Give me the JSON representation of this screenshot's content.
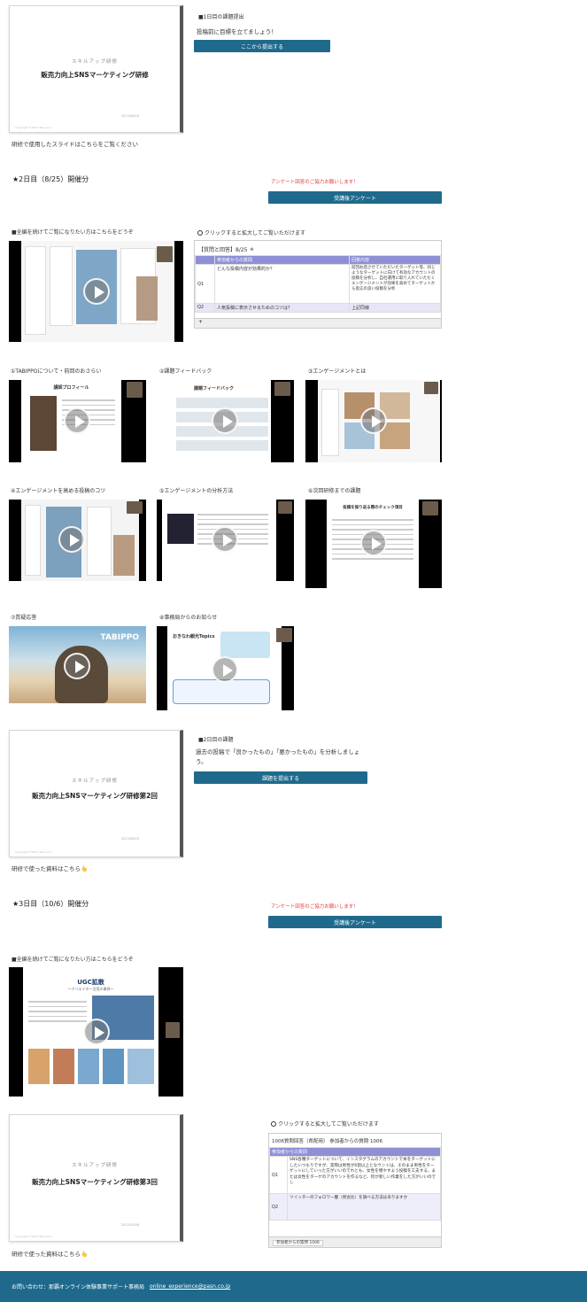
{
  "day1": {
    "slide": {
      "subtitle": "スキルアップ研修",
      "title": "販売力向上SNSマーケティング研修",
      "date": "2023/08/18",
      "footer": "Copyright ©2023 Tokyo Inc."
    },
    "slide_caption": "研修で使用したスライドはこちらをご覧ください",
    "assignment_heading": "■1日目の課題提出",
    "assignment_text": "投稿前に目標を立てましょう！",
    "submit_button": "ここから提出する"
  },
  "day2": {
    "heading": "★2日目（8/25）開催分",
    "survey_notice": "アンケート回答のご協力お願いします！",
    "survey_button": "受講後アンケート",
    "full_video_caption": "■全編を続けてご覧になりたい方はこちらをどうぞ",
    "sheet_hint": "クリックすると拡大してご覧いただけます",
    "sheet": {
      "title": "【質問と回答】8/25 ＊",
      "col1": "参加者からの質問",
      "col2": "回答内容",
      "rows": [
        {
          "no": "Q1",
          "q": "どんな投稿内容が効果的か？",
          "a": "前回お話させていただいたターゲット等、同じようなターゲットに向けて有効なアカウントの投稿を分析し、自社運用に取り入れていただくエンゲージメントが効果を高めてターゲットから反応の良い投稿を分析"
        },
        {
          "no": "Q2",
          "q": "人気投稿に表示させるためのコツは？",
          "a": "上記同様"
        }
      ],
      "tab": "+"
    },
    "videos": [
      {
        "caption": "①TABIPPOについて・前回のおさらい",
        "slide_title": "講師プロフィール"
      },
      {
        "caption": "②課題フィードバック",
        "slide_title": "課題フィードバック"
      },
      {
        "caption": "③エンゲージメントとは",
        "slide_title": ""
      },
      {
        "caption": "④エンゲージメントを高める投稿のコツ",
        "slide_title": ""
      },
      {
        "caption": "⑤エンゲージメントの分析方法",
        "slide_title": ""
      },
      {
        "caption": "⑥次回研修までの課題",
        "slide_title": "投稿を振り返る際のチェック項目"
      },
      {
        "caption": "⑦質疑応答",
        "slide_title": "TABIPPO"
      },
      {
        "caption": "⑧事務局からのお知らせ",
        "slide_title": "おきなわ観光Topics"
      }
    ],
    "slide": {
      "subtitle": "スキルアップ研修",
      "title": "販売力向上SNSマーケティング研修第2回",
      "date": "2023/08/25",
      "footer": "Copyright ©2023 Tokyo Inc."
    },
    "slide_caption": "研修で使った資料はこちら👆",
    "assignment_heading": "■2日目の課題",
    "assignment_text": "過去の投稿で「良かったもの」「悪かったもの」を分析しましょう。",
    "submit_button": "課題を提出する"
  },
  "day3": {
    "heading": "★3日目（10/6）開催分",
    "survey_notice": "アンケート回答のご協力お願いします！",
    "survey_button": "受講後アンケート",
    "full_video_caption": "■全編を続けてご覧になりたい方はこちらをどうぞ",
    "video_title": "UGC拡散",
    "video_sub": "〜クリエイター活用の事例〜",
    "slide": {
      "subtitle": "スキルアップ研修",
      "title": "販売力向上SNSマーケティング研修第3回",
      "date": "2023/10/06",
      "footer": "Copyright ©2023 Tokyo Inc."
    },
    "slide_caption": "研修で使った資料はこちら👆",
    "sheet_hint": "クリックすると拡大してご覧いただけます",
    "sheet": {
      "title": "1006質問回答（県配用） 参加者からの質問 1006",
      "col1": "参加者からの質問",
      "rows": [
        {
          "no": "Q1",
          "q": "SNS各種ターゲットについて、インスタグラムのアカウントで本をターゲットにしたいつもりですが、実際は男性が6割以上となウントは、そのまま男性をターゲットにしていった方がいいのでれとも、女性を増やすよう投稿を工夫する、または女性をターゲのアカウントを作るなど、何が新しい作業をした方がいいのでし"
        },
        {
          "no": "Q2",
          "q": "ツイッターのフォロワー層（男女比）を調べる方法はありますか"
        }
      ],
      "tab": "参加者からの質問 1006"
    }
  },
  "footer": {
    "contact": "お問い合わせ：那覇オンライン体験事業サポート事務局",
    "email": "online_experience@pasn.co.jp"
  }
}
